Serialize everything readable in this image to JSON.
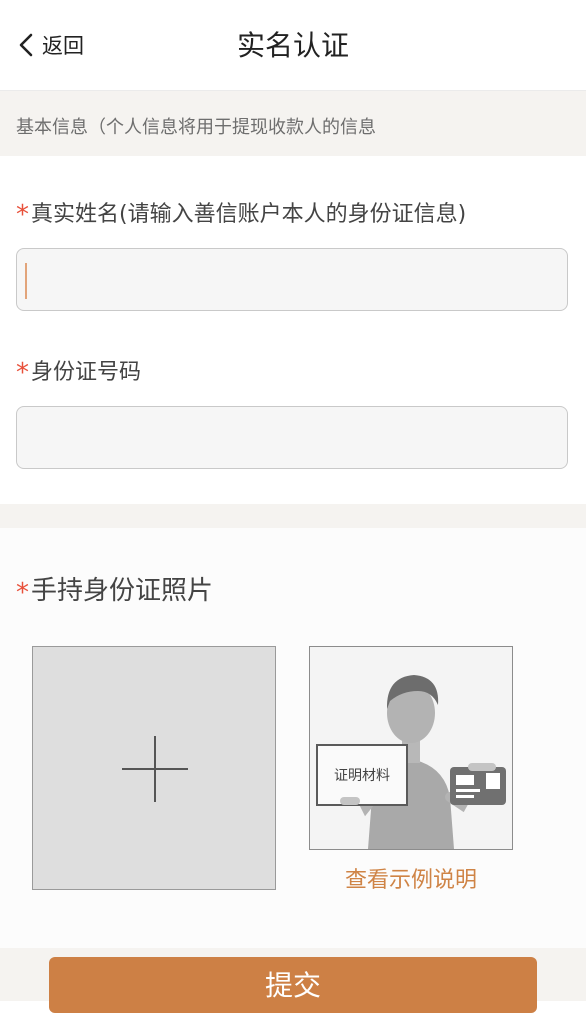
{
  "header": {
    "back_label": "返回",
    "title": "实名认证"
  },
  "info_bar": {
    "text": "基本信息（个人信息将用于提现收款人的信息"
  },
  "form": {
    "required_mark": "*",
    "name_label": "真实姓名(请输入善信账户本人的身份证信息)",
    "name_value": "",
    "id_label": "身份证号码",
    "id_value": ""
  },
  "photo": {
    "label": "手持身份证照片",
    "example_card_text": "证明材料",
    "example_link": "查看示例说明"
  },
  "footer": {
    "submit_label": "提交"
  },
  "colors": {
    "accent": "#cd8045",
    "link": "#cf8446",
    "required": "#e8503a"
  }
}
